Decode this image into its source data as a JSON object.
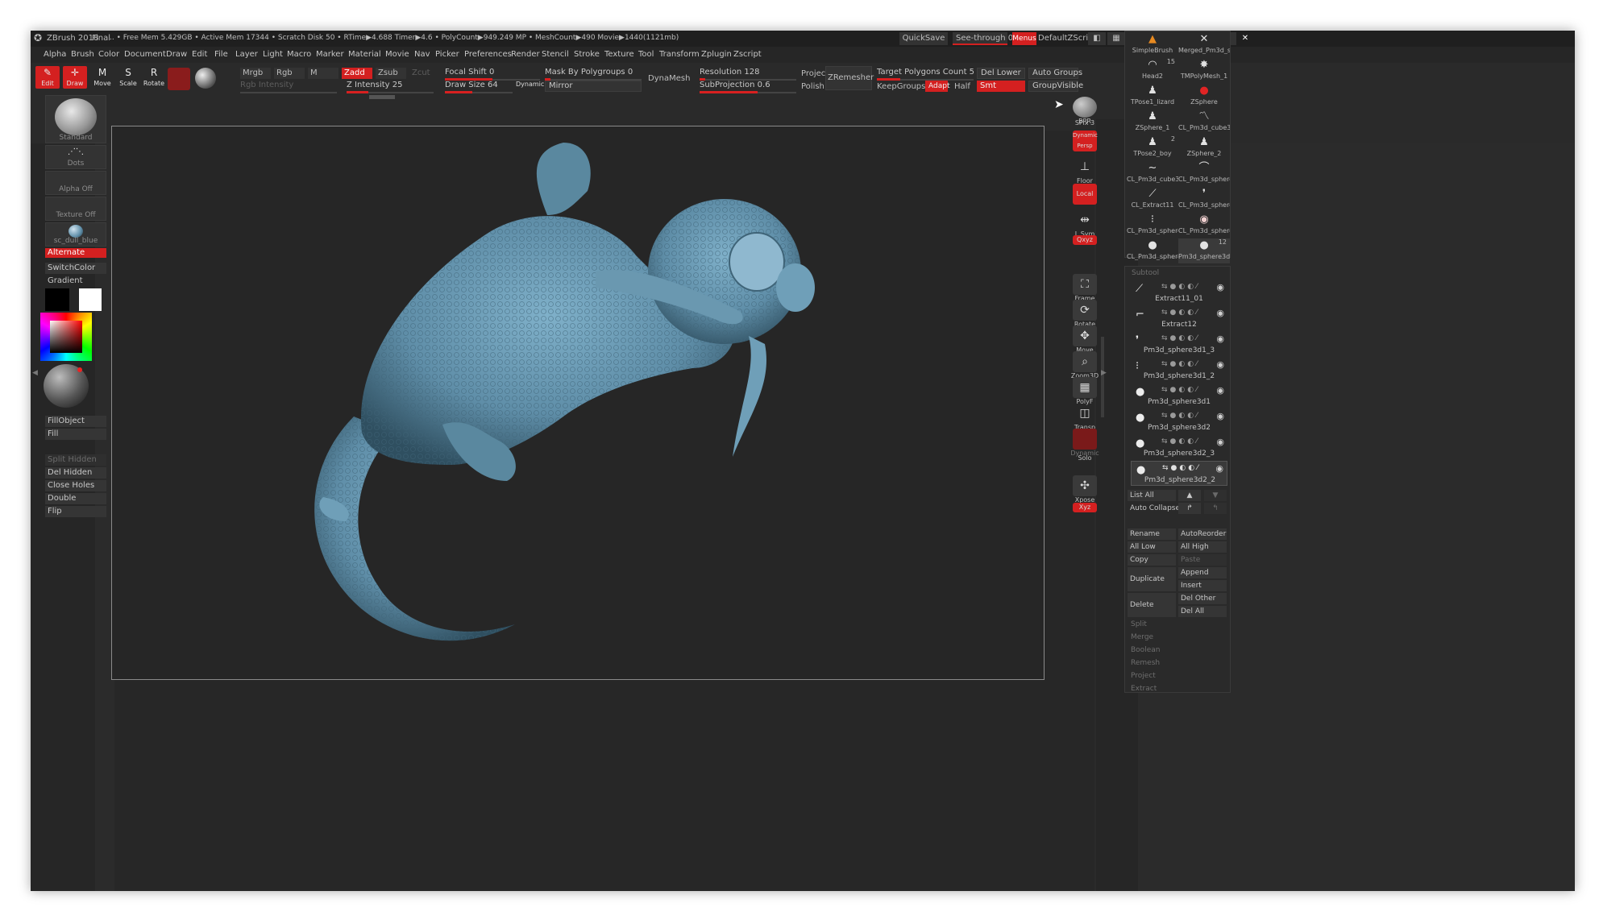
{
  "titlebar": {
    "app": "ZBrush 2018",
    "final": "Final",
    "stats": ".. • Free Mem 5.429GB • Active Mem 17344 • Scratch Disk 50 • RTime▶4.688 Timer▶4.6 • PolyCount▶949.249 MP • MeshCount▶490 Movie▶1440(1121mb)",
    "quicksave": "QuickSave",
    "see_through": "See-through 0",
    "menus_btn": "Menus",
    "default_zscript": "DefaultZScript"
  },
  "menubar": [
    "Alpha",
    "Brush",
    "Color",
    "Document",
    "Draw",
    "Edit",
    "File",
    "Layer",
    "Light",
    "Macro",
    "Marker",
    "Material",
    "Movie",
    "Nav",
    "Picker",
    "Preferences",
    "Render",
    "Stencil",
    "Stroke",
    "Texture",
    "Tool",
    "Transform",
    "Zplugin",
    "Zscript"
  ],
  "toolbar": {
    "edit": "Edit",
    "draw": "Draw",
    "move": "Move",
    "scale": "Scale",
    "rotate": "Rotate",
    "mrgb": "Mrgb",
    "rgb": "Rgb",
    "m": "M",
    "zadd": "Zadd",
    "zsub": "Zsub",
    "zcut": "Zcut",
    "rgb_intensity": "Rgb Intensity",
    "z_intensity": "Z Intensity 25",
    "z_intensity_value": 25,
    "focal_shift": "Focal Shift 0",
    "focal_shift_value": 0,
    "draw_size": "Draw Size 64",
    "draw_size_value": 64,
    "dynamic": "Dynamic",
    "mask_by_polygroups": "Mask By Polygroups 0",
    "mirror": "Mirror",
    "dynamesh": "DynaMesh",
    "resolution": "Resolution 128",
    "resolution_value": 128,
    "subprojection": "SubProjection 0.6",
    "subprojection_value": 0.6,
    "project": "Project",
    "polish": "Polish",
    "zremesher": "ZRemesher",
    "target_polygons": "Target Polygons Count 5",
    "target_polygons_value": 5,
    "keepgroups": "KeepGroups",
    "adapt": "Adapt",
    "half": "Half",
    "del_lower": "Del Lower",
    "smt": "Smt",
    "auto_groups": "Auto Groups",
    "groupvisible": "GroupVisible"
  },
  "leftshelf": {
    "brush": "Standard",
    "stroke": "Dots",
    "alpha": "Alpha Off",
    "texture": "Texture Off",
    "material": "sc_dull_blue",
    "alternate": "Alternate",
    "switchcolor": "SwitchColor",
    "gradient": "Gradient",
    "buttons": [
      "FillObject",
      "Fill",
      "Split Hidden",
      "Del Hidden",
      "Close Holes",
      "Double",
      "Flip"
    ]
  },
  "rightshelf": {
    "bpr": "BPR",
    "spix": "SPix 3",
    "dynamic": "Dynamic",
    "persp": "Persp",
    "floor": "Floor",
    "local": "Local",
    "lsym": "L.Sym",
    "xyz": "Qxyz",
    "frame": "Frame",
    "rotate": "Rotate",
    "move": "Move",
    "zoom3d": "Zoom3D",
    "polyf": "PolyF",
    "line_fill": "Line Fill",
    "transp": "Transp",
    "dynamic2": "Dynamic",
    "solo": "Solo",
    "xpose": "Xpose",
    "xyz2": "Xyz"
  },
  "tools": [
    {
      "name": "SimpleBrush",
      "icon": "▲"
    },
    {
      "name": "Merged_Pm3d_s",
      "icon": "✕"
    },
    {
      "name": "Head2",
      "icon": "◠",
      "count": "15"
    },
    {
      "name": "TMPolyMesh_1",
      "icon": "✸"
    },
    {
      "name": "TPose1_lizard",
      "icon": "♟"
    },
    {
      "name": "ZSphere",
      "icon": "●"
    },
    {
      "name": "ZSphere_1",
      "icon": "♟"
    },
    {
      "name": "CL_Pm3d_cube3d",
      "icon": "〽"
    },
    {
      "name": "TPose2_boy",
      "icon": "♟",
      "count": "2"
    },
    {
      "name": "ZSphere_2",
      "icon": "♟"
    },
    {
      "name": "CL_Pm3d_cube3d",
      "icon": "~"
    },
    {
      "name": "CL_Pm3d_sphere",
      "icon": "⌒"
    },
    {
      "name": "CL_Extract11",
      "icon": "⟋"
    },
    {
      "name": "CL_Pm3d_sphere",
      "icon": "❜"
    },
    {
      "name": "CL_Pm3d_sphere",
      "icon": "⁝"
    },
    {
      "name": "CL_Pm3d_sphere",
      "icon": "◉"
    },
    {
      "name": "CL_Pm3d_sphere",
      "icon": "●"
    },
    {
      "name": "Pm3d_sphere3d",
      "icon": "●",
      "count": "12"
    }
  ],
  "subtool": {
    "title": "Subtool",
    "items": [
      {
        "name": "Extract11_01",
        "icon": "⟋"
      },
      {
        "name": "Extract12",
        "icon": "⌐"
      },
      {
        "name": "Pm3d_sphere3d1_3",
        "icon": "❜"
      },
      {
        "name": "Pm3d_sphere3d1_2",
        "icon": "⁝"
      },
      {
        "name": "Pm3d_sphere3d1",
        "icon": "●"
      },
      {
        "name": "Pm3d_sphere3d2",
        "icon": "●"
      },
      {
        "name": "Pm3d_sphere3d2_3",
        "icon": "●"
      },
      {
        "name": "Pm3d_sphere3d2_2",
        "icon": "●"
      }
    ],
    "list_all": "List All",
    "auto_collapse": "Auto Collapse",
    "rename": "Rename",
    "autoreorder": "AutoReorder",
    "all_low": "All Low",
    "all_high": "All High",
    "copy": "Copy",
    "paste": "Paste",
    "duplicate": "Duplicate",
    "append": "Append",
    "insert": "Insert",
    "delete": "Delete",
    "del_other": "Del Other",
    "del_all": "Del All",
    "split": "Split",
    "merge": "Merge",
    "boolean": "Boolean",
    "remesh": "Remesh",
    "project": "Project",
    "extract": "Extract"
  },
  "colors": {
    "accent_red": "#d42020",
    "model_blue": "#5f8ea8"
  }
}
